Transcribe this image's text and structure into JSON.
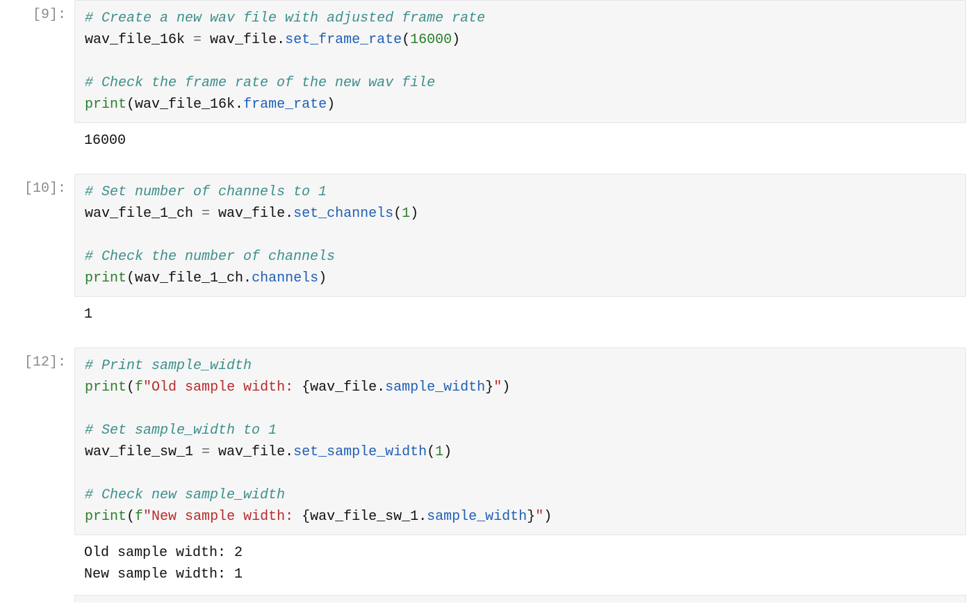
{
  "cells": [
    {
      "prompt": "[9]:",
      "c1": "# Create a new wav file with adjusted frame rate",
      "l2_a": "wav_file_16k ",
      "l2_op": "=",
      "l2_b": " wav_file.",
      "l2_m": "set_frame_rate",
      "l2_p1": "(",
      "l2_n": "16000",
      "l2_p2": ")",
      "c3": "# Check the frame rate of the new wav file",
      "l4_fn": "print",
      "l4_p1": "(",
      "l4_a": "wav_file_16k.",
      "l4_m": "frame_rate",
      "l4_p2": ")",
      "output": "16000"
    },
    {
      "prompt": "[10]:",
      "c1": "# Set number of channels to 1",
      "l2_a": "wav_file_1_ch ",
      "l2_op": "=",
      "l2_b": " wav_file.",
      "l2_m": "set_channels",
      "l2_p1": "(",
      "l2_n": "1",
      "l2_p2": ")",
      "c3": "# Check the number of channels",
      "l4_fn": "print",
      "l4_p1": "(",
      "l4_a": "wav_file_1_ch.",
      "l4_m": "channels",
      "l4_p2": ")",
      "output": "1"
    },
    {
      "prompt": "[12]:",
      "c1": "# Print sample_width",
      "l2_fn": "print",
      "l2_p1": "(",
      "l2_f": "f",
      "l2_s1": "\"Old sample width: ",
      "l2_b1": "{",
      "l2_e1a": "wav_file.",
      "l2_e1m": "sample_width",
      "l2_b2": "}",
      "l2_s2": "\"",
      "l2_p2": ")",
      "c3": "# Set sample_width to 1",
      "l4_a": "wav_file_sw_1 ",
      "l4_op": "=",
      "l4_b": " wav_file.",
      "l4_m": "set_sample_width",
      "l4_p1": "(",
      "l4_n": "1",
      "l4_p2": ")",
      "c5": "# Check new sample_width",
      "l6_fn": "print",
      "l6_p1": "(",
      "l6_f": "f",
      "l6_s1": "\"New sample width: ",
      "l6_b1": "{",
      "l6_e1a": "wav_file_sw_1.",
      "l6_e1m": "sample_width",
      "l6_b2": "}",
      "l6_s2": "\"",
      "l6_p2": ")",
      "output": "Old sample width: 2\nNew sample width: 1"
    }
  ]
}
